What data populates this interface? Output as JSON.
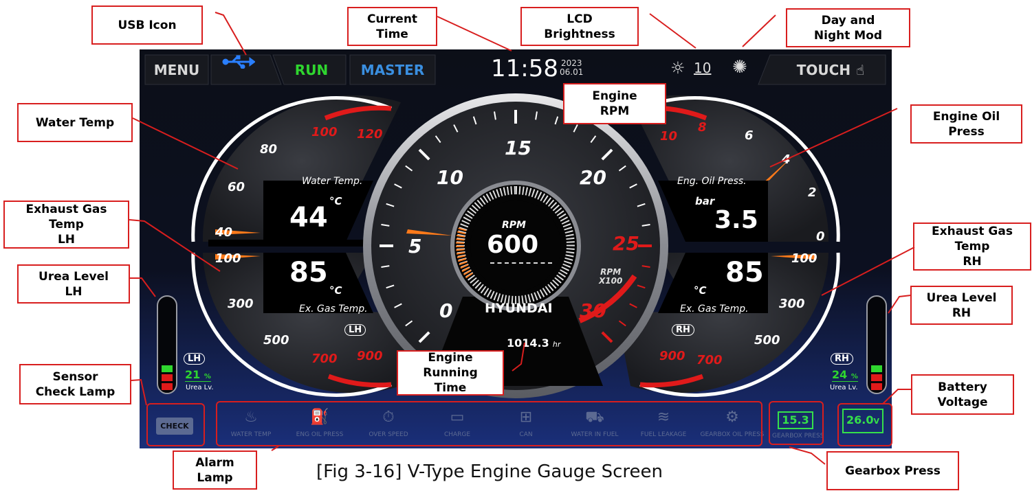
{
  "callouts": {
    "usb": "USB Icon",
    "current_time": "Current\nTime",
    "lcd": "LCD\nBrightness",
    "daynight": "Day and\nNight Mod",
    "water_temp": "Water Temp",
    "engine_rpm": "Engine\nRPM",
    "engine_oil": "Engine Oil\nPress",
    "exhaust_lh": "Exhaust Gas\nTemp\nLH",
    "exhaust_rh": "Exhaust Gas\nTemp\nRH",
    "urea_lh": "Urea Level\nLH",
    "urea_rh": "Urea Level\nRH",
    "sensor_check": "Sensor\nCheck Lamp",
    "engine_running": "Engine\nRunning\nTime",
    "battery": "Battery\nVoltage",
    "alarm": "Alarm\nLamp",
    "gearbox": "Gearbox Press"
  },
  "caption": "[Fig 3-16] V-Type Engine Gauge Screen",
  "header": {
    "menu": "MENU",
    "run": "RUN",
    "master": "MASTER",
    "time": "11:58",
    "year": "2023",
    "date": "06.01",
    "brightness": "10",
    "touch": "TOUCH"
  },
  "water_gauge": {
    "label": "Water Temp.",
    "unit": "°C",
    "value": "44",
    "ticks": [
      "40",
      "60",
      "80",
      "100",
      "120"
    ]
  },
  "exgas_lh": {
    "label": "Ex. Gas Temp.",
    "unit": "°C",
    "value": "85",
    "ticks": [
      "100",
      "300",
      "500",
      "700",
      "900"
    ],
    "side": "LH"
  },
  "oil_gauge": {
    "label": "Eng. Oil Press.",
    "unit": "bar",
    "value": "3.5",
    "ticks": [
      "0",
      "2",
      "4",
      "6",
      "8",
      "10"
    ]
  },
  "exgas_rh": {
    "label": "Ex. Gas Temp.",
    "unit": "°C",
    "value": "85",
    "ticks": [
      "100",
      "300",
      "500",
      "700",
      "900"
    ],
    "side": "RH"
  },
  "rpm_gauge": {
    "label": "RPM",
    "value": "600",
    "ticks": [
      "0",
      "5",
      "10",
      "15",
      "20",
      "25",
      "30"
    ],
    "scale": "RPM\nX100",
    "brand": "HYUNDAI",
    "hours": "1014.3",
    "hours_unit": "hr"
  },
  "urea_lh": {
    "side": "LH",
    "value": "21",
    "unit": "%",
    "label": "Urea Lv.",
    "level": 0.21
  },
  "urea_rh": {
    "side": "RH",
    "value": "24",
    "unit": "%",
    "label": "Urea Lv.",
    "level": 0.24
  },
  "alarms": [
    "WATER TEMP",
    "ENG OIL PRESS",
    "OVER SPEED",
    "CHARGE",
    "CAN",
    "WATER IN FUEL",
    "FUEL LEAKAGE",
    "GEARBOX OIL PRESS",
    "GEARBOX PRESS"
  ],
  "check_lamp": "CHECK",
  "gearbox_press": "15.3",
  "battery": {
    "value": "26.0",
    "unit": "V"
  },
  "colors": {
    "run": "#2fd62f",
    "master": "#3a8fe0",
    "usb": "#2a7fff",
    "redline": "#e01a1a",
    "needle": "#ff7a1a",
    "digital": "#35e04a"
  }
}
